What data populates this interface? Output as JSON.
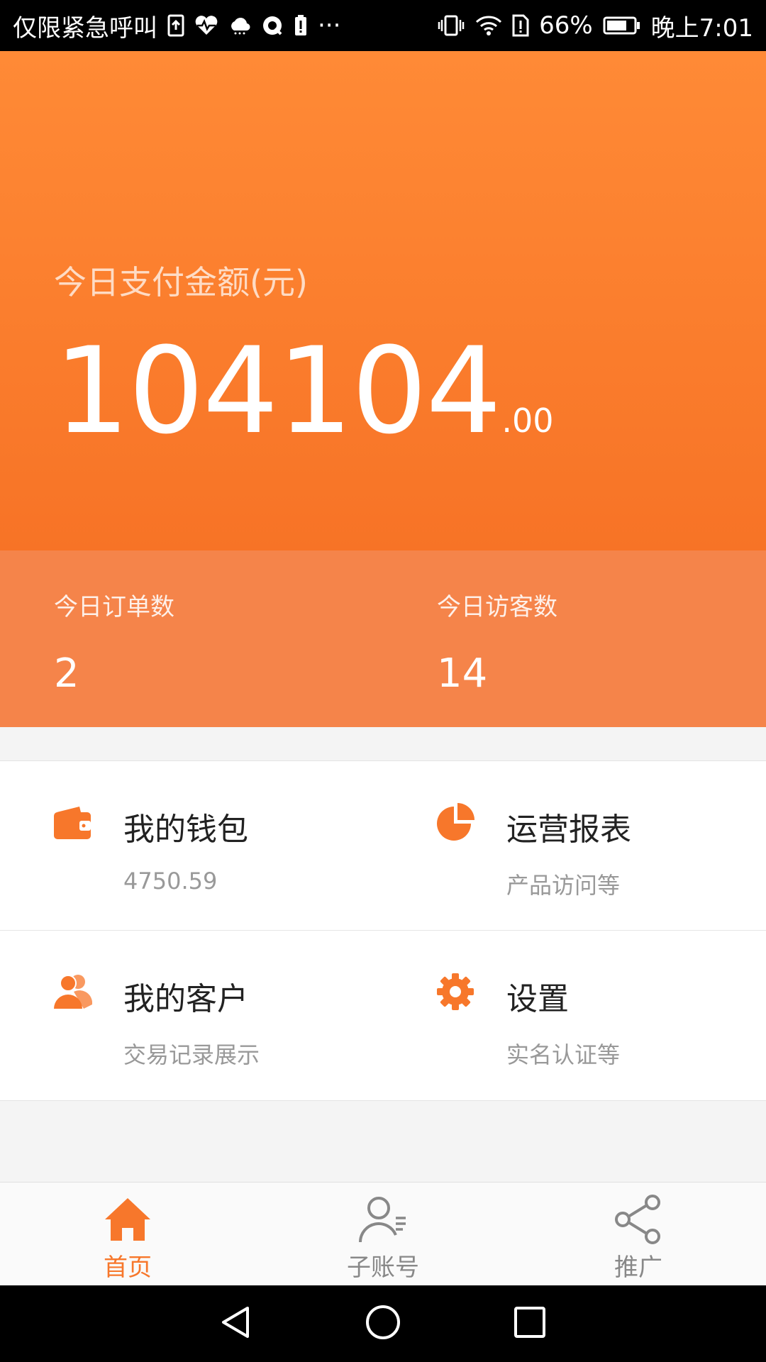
{
  "status_bar": {
    "left_text": "仅限紧急呼叫",
    "battery_text": "66%",
    "time": "晚上7:01",
    "more": "···",
    "icons": [
      "upload-icon",
      "heart-rate-icon",
      "cloud-icon",
      "chat-icon",
      "battery-alert-icon",
      "vibrate-icon",
      "wifi-icon",
      "storage-alert-icon",
      "battery-icon"
    ]
  },
  "hero": {
    "label": "今日支付金额(元)",
    "amount_int": "104104",
    "amount_dec": ".00"
  },
  "stats": {
    "orders_label": "今日订单数",
    "orders_value": "2",
    "visitors_label": "今日访客数",
    "visitors_value": "14"
  },
  "tiles": [
    {
      "title": "我的钱包",
      "subtitle": "4750.59",
      "icon": "wallet-icon"
    },
    {
      "title": "运营报表",
      "subtitle": "产品访问等",
      "icon": "pie-chart-icon"
    },
    {
      "title": "我的客户",
      "subtitle": "交易记录展示",
      "icon": "customers-icon"
    },
    {
      "title": "设置",
      "subtitle": "实名认证等",
      "icon": "gear-icon"
    }
  ],
  "bottom_nav": [
    {
      "label": "首页",
      "icon": "home-icon",
      "active": true
    },
    {
      "label": "子账号",
      "icon": "sub-account-icon",
      "active": false
    },
    {
      "label": "推广",
      "icon": "share-icon",
      "active": false
    }
  ],
  "colors": {
    "accent": "#f7772b",
    "hero_top": "#ff8a36",
    "hero_bottom": "#f77326",
    "stats_bg": "#f5844a"
  }
}
